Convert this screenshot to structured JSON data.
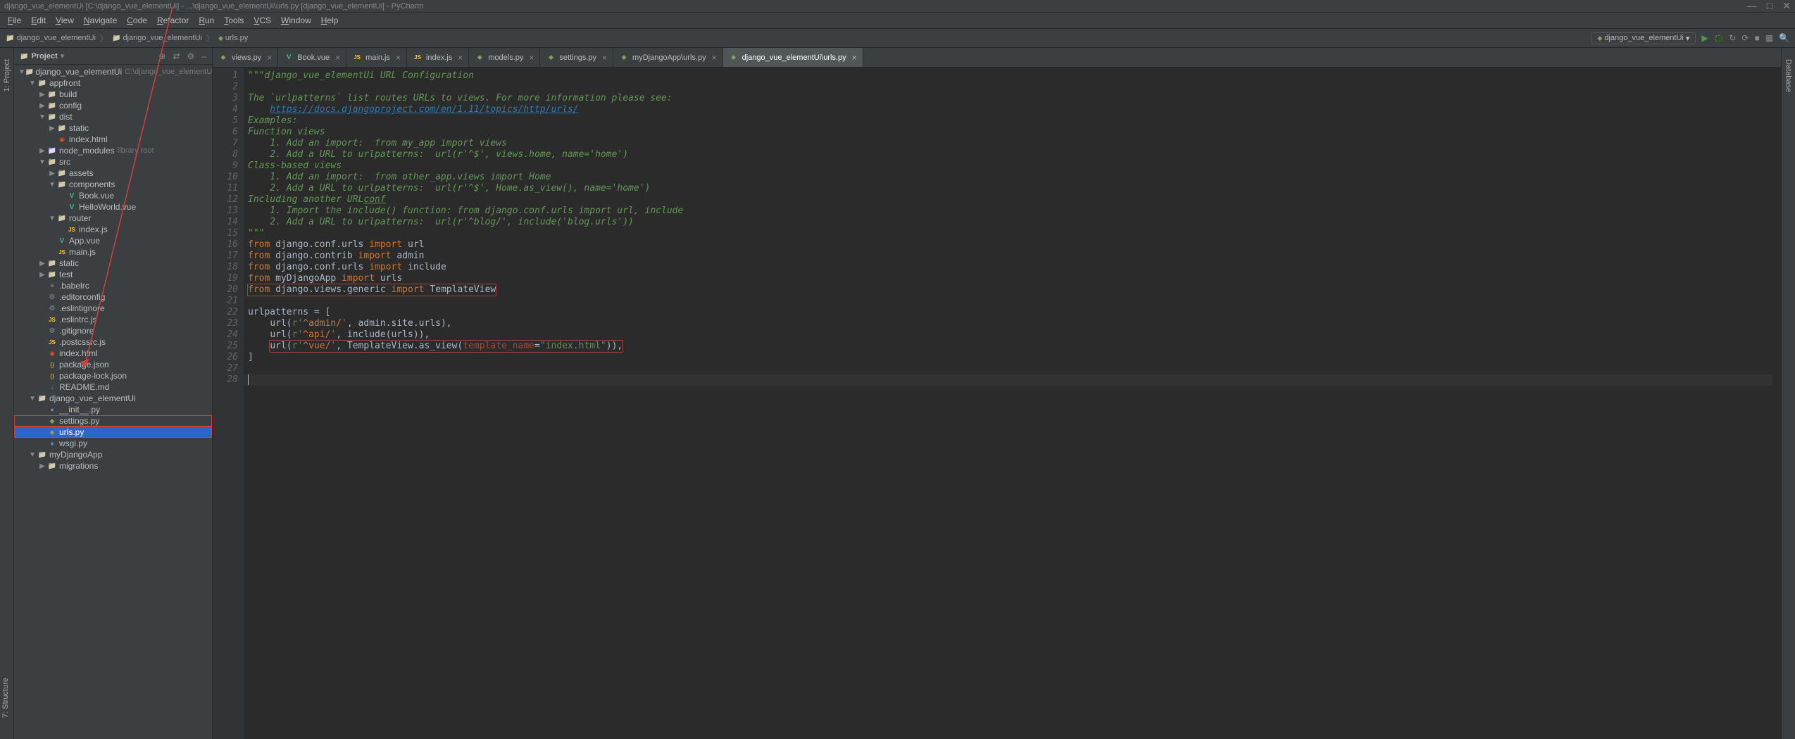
{
  "window": {
    "title": "django_vue_elementUi [C:\\django_vue_elementUi] - ...\\django_vue_elementUi\\urls.py [django_vue_elementUi] - PyCharm",
    "minimize": "—",
    "maximize": "□",
    "close": "✕"
  },
  "menu": [
    "File",
    "Edit",
    "View",
    "Navigate",
    "Code",
    "Refactor",
    "Run",
    "Tools",
    "VCS",
    "Window",
    "Help"
  ],
  "breadcrumb": [
    {
      "icon": "folder",
      "label": "django_vue_elementUi"
    },
    {
      "icon": "folder",
      "label": "django_vue_elementUi"
    },
    {
      "icon": "dj",
      "label": "urls.py"
    }
  ],
  "run_config": {
    "label": "django_vue_elementUi",
    "caret": "▾"
  },
  "toolbar_icons": [
    "run",
    "debug",
    "restart",
    "update",
    "stop",
    "apps",
    "search"
  ],
  "project_panel": {
    "title": "Project",
    "actions": [
      "⊕",
      "⇄",
      "⚙",
      "–"
    ],
    "side_tab_top": "1: Project",
    "side_tab_bottom": "7: Structure",
    "right_side_tab": "Database"
  },
  "tree": [
    {
      "depth": 0,
      "arrow": "▼",
      "icon": "folder",
      "label": "django_vue_elementUi",
      "note": "C:\\django_vue_elementUi"
    },
    {
      "depth": 1,
      "arrow": "▼",
      "icon": "folder",
      "label": "appfront"
    },
    {
      "depth": 2,
      "arrow": "▶",
      "icon": "folder",
      "label": "build"
    },
    {
      "depth": 2,
      "arrow": "▶",
      "icon": "folder",
      "label": "config"
    },
    {
      "depth": 2,
      "arrow": "▼",
      "icon": "folder",
      "label": "dist"
    },
    {
      "depth": 3,
      "arrow": "▶",
      "icon": "folder",
      "label": "static"
    },
    {
      "depth": 3,
      "arrow": "",
      "icon": "html",
      "label": "index.html"
    },
    {
      "depth": 2,
      "arrow": "▶",
      "icon": "folder-lib",
      "label": "node_modules",
      "note": "library root"
    },
    {
      "depth": 2,
      "arrow": "▼",
      "icon": "folder",
      "label": "src"
    },
    {
      "depth": 3,
      "arrow": "▶",
      "icon": "folder",
      "label": "assets"
    },
    {
      "depth": 3,
      "arrow": "▼",
      "icon": "folder",
      "label": "components"
    },
    {
      "depth": 4,
      "arrow": "",
      "icon": "vue",
      "label": "Book.vue"
    },
    {
      "depth": 4,
      "arrow": "",
      "icon": "vue",
      "label": "HelloWorld.vue"
    },
    {
      "depth": 3,
      "arrow": "▼",
      "icon": "folder",
      "label": "router"
    },
    {
      "depth": 4,
      "arrow": "",
      "icon": "js",
      "label": "index.js"
    },
    {
      "depth": 3,
      "arrow": "",
      "icon": "vue",
      "label": "App.vue"
    },
    {
      "depth": 3,
      "arrow": "",
      "icon": "js",
      "label": "main.js"
    },
    {
      "depth": 2,
      "arrow": "▶",
      "icon": "folder",
      "label": "static"
    },
    {
      "depth": 2,
      "arrow": "▶",
      "icon": "folder",
      "label": "test"
    },
    {
      "depth": 2,
      "arrow": "",
      "icon": "txt",
      "label": ".babelrc"
    },
    {
      "depth": 2,
      "arrow": "",
      "icon": "cfg",
      "label": ".editorconfig"
    },
    {
      "depth": 2,
      "arrow": "",
      "icon": "gear",
      "label": ".eslintignore"
    },
    {
      "depth": 2,
      "arrow": "",
      "icon": "js",
      "label": ".eslintrc.js"
    },
    {
      "depth": 2,
      "arrow": "",
      "icon": "gear",
      "label": ".gitignore"
    },
    {
      "depth": 2,
      "arrow": "",
      "icon": "js",
      "label": ".postcssrc.js"
    },
    {
      "depth": 2,
      "arrow": "",
      "icon": "html",
      "label": "index.html"
    },
    {
      "depth": 2,
      "arrow": "",
      "icon": "json",
      "label": "package.json"
    },
    {
      "depth": 2,
      "arrow": "",
      "icon": "json",
      "label": "package-lock.json"
    },
    {
      "depth": 2,
      "arrow": "",
      "icon": "md",
      "label": "README.md"
    },
    {
      "depth": 1,
      "arrow": "▼",
      "icon": "folder",
      "label": "django_vue_elementUi"
    },
    {
      "depth": 2,
      "arrow": "",
      "icon": "py",
      "label": "__init__.py"
    },
    {
      "depth": 2,
      "arrow": "",
      "icon": "dj",
      "label": "settings.py",
      "box": true
    },
    {
      "depth": 2,
      "arrow": "",
      "icon": "dj",
      "label": "urls.py",
      "selected": true,
      "box": true
    },
    {
      "depth": 2,
      "arrow": "",
      "icon": "py",
      "label": "wsgi.py"
    },
    {
      "depth": 1,
      "arrow": "▼",
      "icon": "folder",
      "label": "myDjangoApp"
    },
    {
      "depth": 2,
      "arrow": "▶",
      "icon": "folder",
      "label": "migrations"
    }
  ],
  "tabs": [
    {
      "icon": "dj",
      "label": "views.py",
      "active": false
    },
    {
      "icon": "vue",
      "label": "Book.vue",
      "active": false
    },
    {
      "icon": "js",
      "label": "main.js",
      "active": false
    },
    {
      "icon": "js",
      "label": "index.js",
      "active": false
    },
    {
      "icon": "dj",
      "label": "models.py",
      "active": false
    },
    {
      "icon": "dj",
      "label": "settings.py",
      "active": false
    },
    {
      "icon": "dj",
      "label": "myDjangoApp\\urls.py",
      "active": false
    },
    {
      "icon": "dj",
      "label": "django_vue_elementUi\\urls.py",
      "active": true
    }
  ],
  "editor": {
    "lines": [
      {
        "n": 1,
        "html": "<span class='c-string'>\"\"\"django_vue_elementUi URL Configuration</span>"
      },
      {
        "n": 2,
        "html": ""
      },
      {
        "n": 3,
        "html": "<span class='c-string'>The `urlpatterns` list routes URLs to views. For more information please see:</span>"
      },
      {
        "n": 4,
        "html": "    <span class='c-link'>https://docs.djangoproject.com/en/1.11/topics/http/urls/</span>"
      },
      {
        "n": 5,
        "html": "<span class='c-string'>Examples:</span>"
      },
      {
        "n": 6,
        "html": "<span class='c-string'>Function views</span>"
      },
      {
        "n": 7,
        "html": "<span class='c-string'>    1. Add an import:  from my_app import views</span>"
      },
      {
        "n": 8,
        "html": "<span class='c-string'>    2. Add a URL to urlpatterns:  url(r'^$', views.home, name='home')</span>"
      },
      {
        "n": 9,
        "html": "<span class='c-string'>Class-based views</span>"
      },
      {
        "n": 10,
        "html": "<span class='c-string'>    1. Add an import:  from other_app.views import Home</span>"
      },
      {
        "n": 11,
        "html": "<span class='c-string'>    2. Add a URL to urlpatterns:  url(r'^$', Home.as_view(), name='home')</span>"
      },
      {
        "n": 12,
        "html": "<span class='c-string'>Including another URL<u>conf</u></span>"
      },
      {
        "n": 13,
        "html": "<span class='c-string'>    1. Import the include() function: from django.conf.urls import url, include</span>"
      },
      {
        "n": 14,
        "html": "<span class='c-string'>    2. Add a URL to urlpatterns:  url(r'^blog/', include('blog.urls'))</span>"
      },
      {
        "n": 15,
        "html": "<span class='c-string'>\"\"\"</span>"
      },
      {
        "n": 16,
        "html": "<span class='c-kw'>from</span> <span class='c-ident'>django.conf.urls</span> <span class='c-kw'>import</span> <span class='c-ident'>url</span>"
      },
      {
        "n": 17,
        "html": "<span class='c-kw'>from</span> <span class='c-ident'>django.contrib</span> <span class='c-kw'>import</span> <span class='c-ident'>admin</span>"
      },
      {
        "n": 18,
        "html": "<span class='c-kw'>from</span> <span class='c-ident'>django.conf.urls</span> <span class='c-kw'>import</span> <span class='c-ident'>include</span>"
      },
      {
        "n": 19,
        "html": "<span class='c-kw'>from</span> <span class='c-ident'>myDjangoApp</span> <span class='c-kw'>import</span> <span class='c-ident'>urls</span>"
      },
      {
        "n": 20,
        "html": "<span class='box-red'><span class='c-kw'>from</span> <span class='c-ident'>django.views.generic</span> <span class='c-kw'>import</span> <span class='c-ident'>TemplateView</span></span>"
      },
      {
        "n": 21,
        "html": ""
      },
      {
        "n": 22,
        "html": "<span class='c-ident'>urlpatterns = [</span>"
      },
      {
        "n": 23,
        "html": "    <span class='c-ident'>url(</span><span class='c-str'>r'</span><span class='c-re'>^admin/</span><span class='c-str'>'</span><span class='c-ident'>, admin.site.urls),</span>"
      },
      {
        "n": 24,
        "html": "    <span class='c-ident'>url(</span><span class='c-str'>r'</span><span class='c-re'>^api/</span><span class='c-str'>'</span><span class='c-ident'>, include(urls)),</span>"
      },
      {
        "n": 25,
        "html": "    <span class='box-red'><span class='c-ident'>url(</span><span class='c-str'>r'</span><span class='c-re'>^vue/</span><span class='c-str'>'</span><span class='c-ident'>, TemplateView.as_view(</span><span class='c-param'>template_name</span><span class='c-ident'>=</span><span class='c-str'>\"index.html\"</span><span class='c-ident'>)),</span></span>"
      },
      {
        "n": 26,
        "html": "<span class='c-ident'>]</span>"
      },
      {
        "n": 27,
        "html": ""
      },
      {
        "n": 28,
        "html": "",
        "current": true
      }
    ]
  }
}
